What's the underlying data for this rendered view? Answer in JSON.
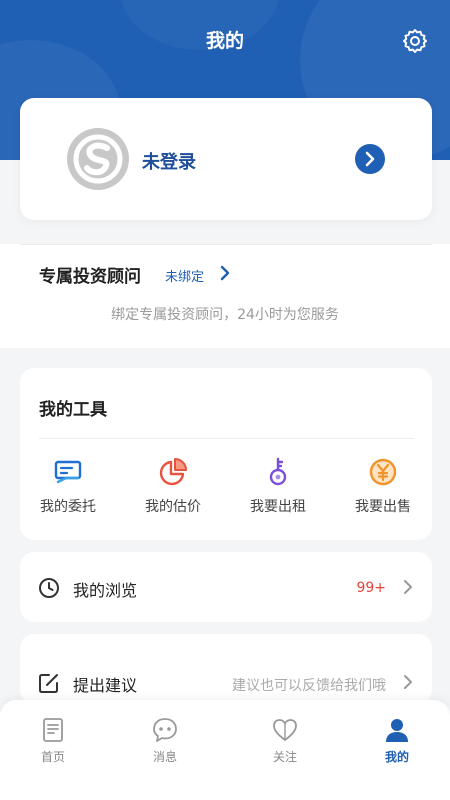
{
  "header": {
    "title": "我的",
    "settings_icon": "gear-icon"
  },
  "login": {
    "status": "未登录",
    "avatar_icon": "logo-avatar-icon",
    "arrow_icon": "chevron-right-icon"
  },
  "advisor": {
    "title": "专属投资顾问",
    "status": "未绑定",
    "description": "绑定专属投资顾问，24小时为您服务"
  },
  "tools": {
    "title": "我的工具",
    "items": [
      {
        "label": "我的委托",
        "icon": "entrust-icon"
      },
      {
        "label": "我的估价",
        "icon": "pie-chart-icon"
      },
      {
        "label": "我要出租",
        "icon": "key-icon"
      },
      {
        "label": "我要出售",
        "icon": "yen-coin-icon"
      }
    ]
  },
  "rows": {
    "history": {
      "label": "我的浏览",
      "value": "99+",
      "icon": "clock-icon"
    },
    "feedback": {
      "label": "提出建议",
      "value": "建议也可以反馈给我们哦",
      "icon": "edit-icon"
    }
  },
  "tabbar": {
    "items": [
      {
        "label": "首页",
        "icon": "home-doc-icon"
      },
      {
        "label": "消息",
        "icon": "message-icon"
      },
      {
        "label": "关注",
        "icon": "heart-icon"
      },
      {
        "label": "我的",
        "icon": "user-icon"
      }
    ],
    "active_index": 3
  },
  "colors": {
    "brand": "#1f5fb4",
    "badge": "#e0443a",
    "estimate": "#e8533f",
    "rent": "#7b4fd6",
    "sell": "#f0932b"
  }
}
